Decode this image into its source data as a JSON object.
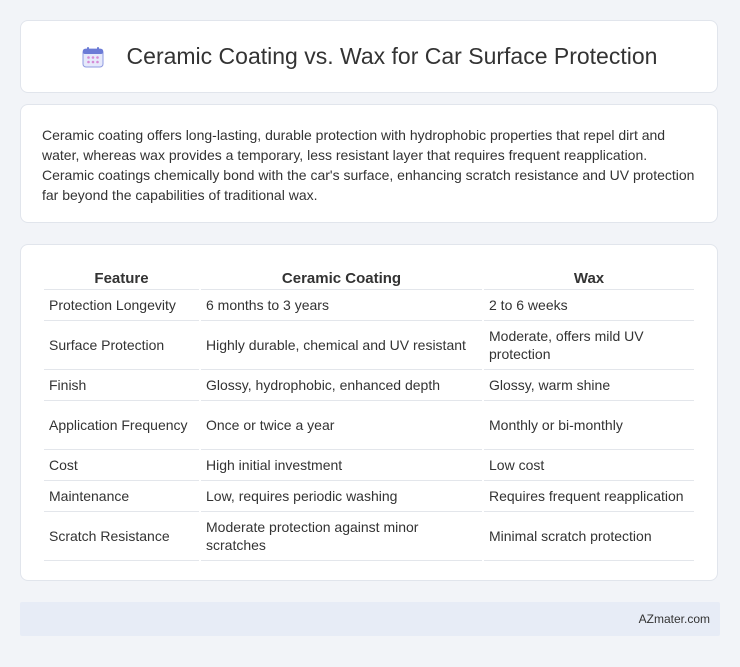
{
  "header": {
    "icon": "calendar-icon",
    "title": "Ceramic Coating vs. Wax for Car Surface Protection"
  },
  "summary": {
    "text": "Ceramic coating offers long-lasting, durable protection with hydrophobic properties that repel dirt and water, whereas wax provides a temporary, less resistant layer that requires frequent reapplication. Ceramic coatings chemically bond with the car's surface, enhancing scratch resistance and UV protection far beyond the capabilities of traditional wax."
  },
  "table": {
    "headers": [
      "Feature",
      "Ceramic Coating",
      "Wax"
    ],
    "rows": [
      [
        "Protection Longevity",
        "6 months to 3 years",
        "2 to 6 weeks"
      ],
      [
        "Surface Protection",
        "Highly durable, chemical and UV resistant",
        "Moderate, offers mild UV protection"
      ],
      [
        "Finish",
        "Glossy, hydrophobic, enhanced depth",
        "Glossy, warm shine"
      ],
      [
        "Application Frequency",
        "Once or twice a year",
        "Monthly or bi-monthly"
      ],
      [
        "Cost",
        "High initial investment",
        "Low cost"
      ],
      [
        "Maintenance",
        "Low, requires periodic washing",
        "Requires frequent reapplication"
      ],
      [
        "Scratch Resistance",
        "Moderate protection against minor scratches",
        "Minimal scratch protection"
      ]
    ]
  },
  "footer": {
    "text": "AZmater.com"
  },
  "colors": {
    "page_background": "#f2f4f8",
    "card_background": "#ffffff",
    "footer_background": "#e7ecf6",
    "icon_accent": "#6b7bd6"
  }
}
